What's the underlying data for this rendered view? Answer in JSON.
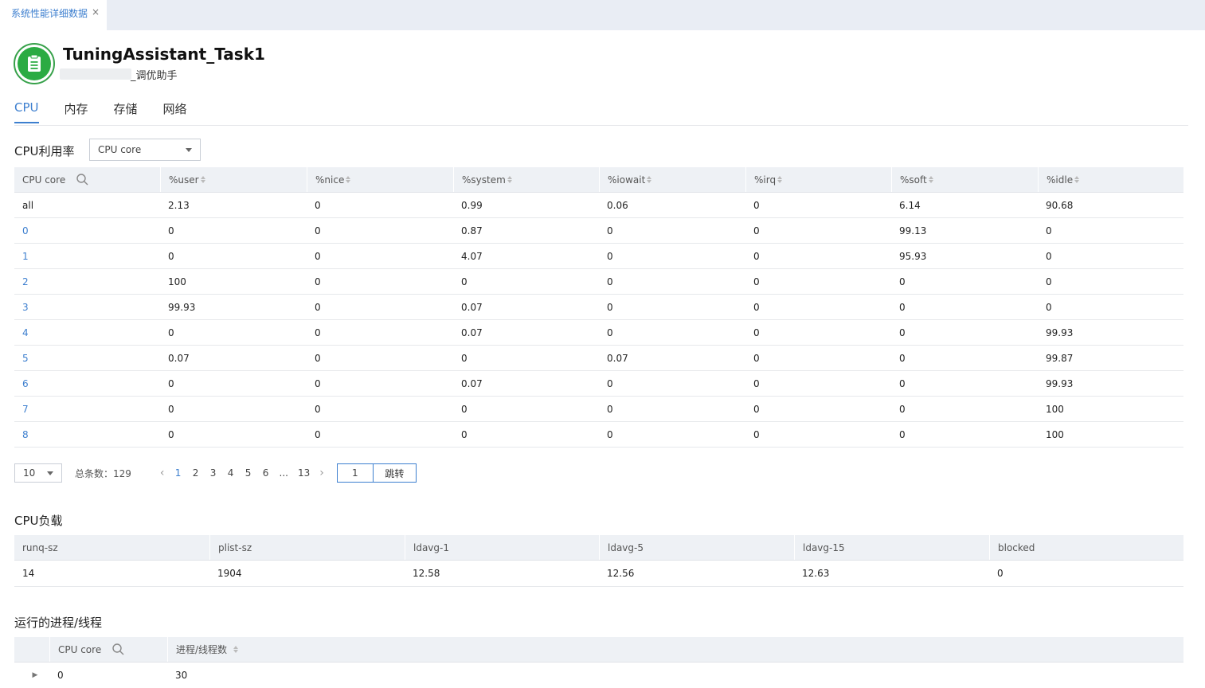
{
  "tab": {
    "label": "系统性能详细数据",
    "close": "×"
  },
  "header": {
    "title": "TuningAssistant_Task1",
    "subtitle": "_调优助手"
  },
  "categories": [
    "CPU",
    "内存",
    "存储",
    "网络"
  ],
  "cpu_usage": {
    "title": "CPU利用率",
    "filter_value": "CPU core",
    "columns": [
      "CPU core",
      "%user",
      "%nice",
      "%system",
      "%iowait",
      "%irq",
      "%soft",
      "%idle"
    ],
    "rows": [
      [
        "all",
        "2.13",
        "0",
        "0.99",
        "0.06",
        "0",
        "6.14",
        "90.68"
      ],
      [
        "0",
        "0",
        "0",
        "0.87",
        "0",
        "0",
        "99.13",
        "0"
      ],
      [
        "1",
        "0",
        "0",
        "4.07",
        "0",
        "0",
        "95.93",
        "0"
      ],
      [
        "2",
        "100",
        "0",
        "0",
        "0",
        "0",
        "0",
        "0"
      ],
      [
        "3",
        "99.93",
        "0",
        "0.07",
        "0",
        "0",
        "0",
        "0"
      ],
      [
        "4",
        "0",
        "0",
        "0.07",
        "0",
        "0",
        "0",
        "99.93"
      ],
      [
        "5",
        "0.07",
        "0",
        "0",
        "0.07",
        "0",
        "0",
        "99.87"
      ],
      [
        "6",
        "0",
        "0",
        "0.07",
        "0",
        "0",
        "0",
        "99.93"
      ],
      [
        "7",
        "0",
        "0",
        "0",
        "0",
        "0",
        "0",
        "100"
      ],
      [
        "8",
        "0",
        "0",
        "0",
        "0",
        "0",
        "0",
        "100"
      ]
    ]
  },
  "pagination": {
    "page_size": "10",
    "total_label": "总条数：129",
    "pages": [
      "1",
      "2",
      "3",
      "4",
      "5",
      "6",
      "...",
      "13"
    ],
    "current": "1",
    "jump_value": "1",
    "jump_label": "跳转"
  },
  "cpu_load": {
    "title": "CPU负载",
    "columns": [
      "runq-sz",
      "plist-sz",
      "ldavg-1",
      "ldavg-5",
      "ldavg-15",
      "blocked"
    ],
    "rows": [
      [
        "14",
        "1904",
        "12.58",
        "12.56",
        "12.63",
        "0"
      ]
    ]
  },
  "processes": {
    "title": "运行的进程/线程",
    "columns": [
      "CPU core",
      "进程/线程数"
    ],
    "rows": [
      [
        "0",
        "30"
      ]
    ]
  },
  "colors": {
    "accent": "#3d7fcf",
    "logo": "#2bab43",
    "header_bg": "#eef1f5"
  },
  "icons": [
    "clipboard-icon",
    "search-icon",
    "sort-icon",
    "chevron-down-icon",
    "chevron-left-icon",
    "chevron-right-icon",
    "expand-arrow-icon"
  ]
}
